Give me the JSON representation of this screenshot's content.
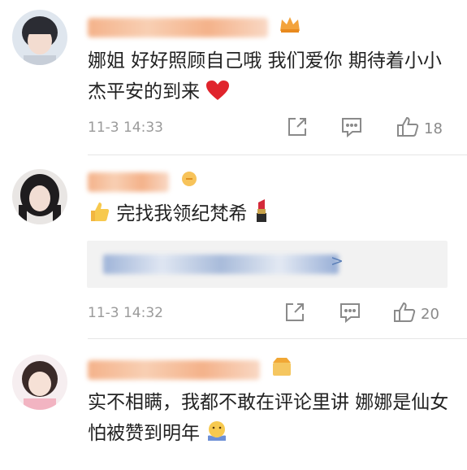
{
  "comments": [
    {
      "username": "娜一…超大…角色",
      "text": "娜姐 好好照顾自己哦 我们爱你 期待着小小杰平安的到来",
      "time": "11-3 14:33",
      "likes": "18"
    },
    {
      "username": "白…",
      "text": "完找我领纪梵希",
      "time": "11-3 14:32",
      "likes": "20",
      "repost_more": ">"
    },
    {
      "username": "…",
      "text": "实不相瞒，我都不敢在评论里讲 娜娜是仙女 怕被赞到明年"
    }
  ],
  "icons": {
    "share": "share-icon",
    "comment": "comment-icon",
    "like": "thumbs-up-icon",
    "heart": "heart-emoji",
    "lipstick": "lipstick-emoji",
    "thumbs_emoji": "thumbs-up-emoji",
    "hug": "hug-emoji",
    "crown": "crown-badge-icon"
  },
  "colors": {
    "username": "#f07b2b",
    "meta": "#9a9a9a",
    "link": "#5b7fb8"
  }
}
